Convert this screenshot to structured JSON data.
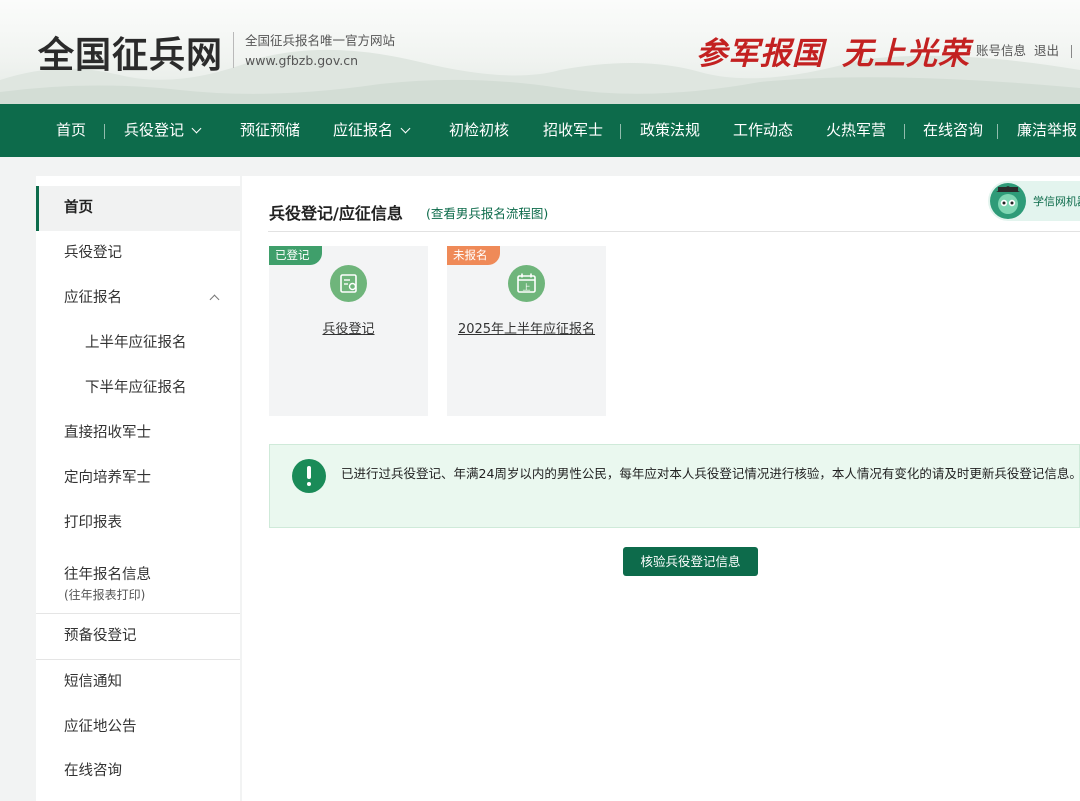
{
  "header": {
    "logo": "全国征兵网",
    "subtitle_line1": "全国征兵报名唯一官方网站",
    "subtitle_line2": "www.gfbzb.gov.cn",
    "slogan_1": "参军报国",
    "slogan_2": "无上光荣",
    "account_label": "账号信息",
    "logout_label": "退出"
  },
  "nav": {
    "items": [
      {
        "label": "首页"
      },
      {
        "label": "兵役登记"
      },
      {
        "label": "预征预储"
      },
      {
        "label": "应征报名"
      },
      {
        "label": "初检初核"
      },
      {
        "label": "招收军士"
      },
      {
        "label": "政策法规"
      },
      {
        "label": "工作动态"
      },
      {
        "label": "火热军营"
      },
      {
        "label": "在线咨询"
      },
      {
        "label": "廉洁举报"
      }
    ]
  },
  "sidebar": {
    "items": [
      {
        "label": "首页"
      },
      {
        "label": "兵役登记"
      },
      {
        "label": "应征报名"
      },
      {
        "label": "上半年应征报名"
      },
      {
        "label": "下半年应征报名"
      },
      {
        "label": "直接招收军士"
      },
      {
        "label": "定向培养军士"
      },
      {
        "label": "打印报表"
      },
      {
        "label": "往年报名信息",
        "sub": "(往年报表打印)"
      },
      {
        "label": "预备役登记"
      },
      {
        "label": "短信通知"
      },
      {
        "label": "应征地公告"
      },
      {
        "label": "在线咨询"
      }
    ]
  },
  "main": {
    "title": "兵役登记/应征信息",
    "flow_link": "(查看男兵报名流程图)",
    "xuexin_label": "学信网机器",
    "cards": [
      {
        "badge": "已登记",
        "label": "兵役登记",
        "icon": "registration-card-icon"
      },
      {
        "badge": "未报名",
        "label": "2025年上半年应征报名",
        "icon": "calendar-icon",
        "icon_text": "上"
      }
    ],
    "notice": "已进行过兵役登记、年满24周岁以内的男性公民，每年应对本人兵役登记情况进行核验，本人情况有变化的请及时更新兵役登记信息。",
    "verify_button": "核验兵役登记信息"
  },
  "colors": {
    "brand_green": "#0d6b4b",
    "slogan_red": "#c32121",
    "badge_done": "#3f9f6b",
    "badge_pending": "#ef8a58"
  }
}
